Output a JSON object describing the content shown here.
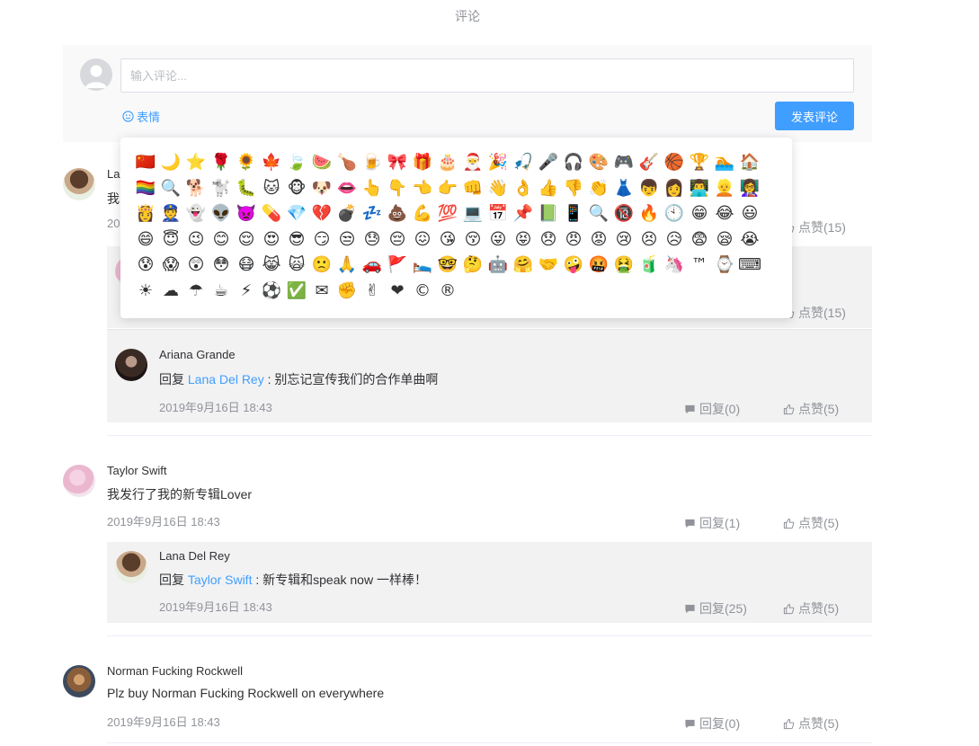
{
  "page": {
    "title": "评论"
  },
  "editor": {
    "placeholder": "输入评论...",
    "emoji_label": "表情",
    "submit_label": "发表评论"
  },
  "emojis": [
    "🇨🇳",
    "🌙",
    "⭐",
    "🌹",
    "🌻",
    "🍁",
    "🍃",
    "🍉",
    "🍗",
    "🍺",
    "🎀",
    "🎁",
    "🎂",
    "🎅",
    "🎉",
    "🎣",
    "🎤",
    "🎧",
    "🎨",
    "🎮",
    "🎸",
    "🏀",
    "🏆",
    "🏊",
    "🏠",
    "🏳️‍🌈",
    "🔍",
    "🐕",
    "🐩",
    "🐛",
    "🐱",
    "🐵",
    "🐶",
    "👄",
    "👆",
    "👇",
    "👈",
    "👉",
    "👊",
    "👋",
    "👌",
    "👍",
    "👎",
    "👏",
    "👗",
    "👦",
    "👩",
    "👨‍💻",
    "👱",
    "👩‍🏫",
    "👸",
    "👮",
    "👻",
    "👽",
    "👿",
    "💊",
    "💎",
    "💔",
    "💣",
    "💤",
    "💩",
    "💪",
    "💯",
    "💻",
    "📅",
    "📌",
    "📗",
    "📱",
    "🔍",
    "🔞",
    "🔥",
    "🕙",
    "😁",
    "😂",
    "😃",
    "😄",
    "😇",
    "😉",
    "😊",
    "😌",
    "😍",
    "😎",
    "😏",
    "😒",
    "😓",
    "😔",
    "😖",
    "😘",
    "😚",
    "😜",
    "😝",
    "😞",
    "😠",
    "😡",
    "😢",
    "😣",
    "😥",
    "😨",
    "😪",
    "😭",
    "😰",
    "😱",
    "😲",
    "😳",
    "😷",
    "😹",
    "🙀",
    "🙁",
    "🙏",
    "🚗",
    "🚩",
    "🛌",
    "🤓",
    "🤔",
    "🤖",
    "🤗",
    "🤝",
    "🤪",
    "🤬",
    "🤮",
    "🧃",
    "🦄",
    "™",
    "⌚",
    "⌨",
    "☀",
    "☁",
    "☂",
    "☕",
    "⚡",
    "⚽",
    "✅",
    "✉",
    "✊",
    "✌",
    "❤",
    "©",
    "®"
  ],
  "comments": [
    {
      "name": "La",
      "content": "我",
      "date": "2019",
      "like_label": "点赞(15)",
      "replies": [
        {
          "like_label": "点赞(15)"
        },
        {
          "name": "Ariana Grande",
          "reply_prefix": "回复",
          "reply_to": "Lana Del Rey",
          "text": ": 别忘记宣传我们的合作单曲啊",
          "date": "2019年9月16日 18:43",
          "reply_label": "回复(0)",
          "like_label": "点赞(5)"
        }
      ]
    },
    {
      "name": "Taylor Swift",
      "content": "我发行了我的新专辑Lover",
      "date": "2019年9月16日 18:43",
      "reply_label": "回复(1)",
      "like_label": "点赞(5)",
      "replies": [
        {
          "name": "Lana Del Rey",
          "reply_prefix": "回复",
          "reply_to": "Taylor Swift",
          "text": ": 新专辑和speak now 一样棒！",
          "date": "2019年9月16日 18:43",
          "reply_label": "回复(25)",
          "like_label": "点赞(5)"
        }
      ]
    },
    {
      "name": "Norman Fucking Rockwell",
      "content": "Plz buy Norman Fucking Rockwell on everywhere",
      "date": "2019年9月16日 18:43",
      "reply_label": "回复(0)",
      "like_label": "点赞(5)"
    }
  ],
  "icons": {
    "reply": "comment-icon",
    "like": "thumb-up-icon",
    "emoji": "smiley-icon",
    "avatar_default": "user-icon"
  },
  "colors": {
    "accent": "#409eff",
    "muted": "#909399",
    "reply_bg": "#f2f2f3",
    "editor_bg": "#f9f9fa"
  }
}
